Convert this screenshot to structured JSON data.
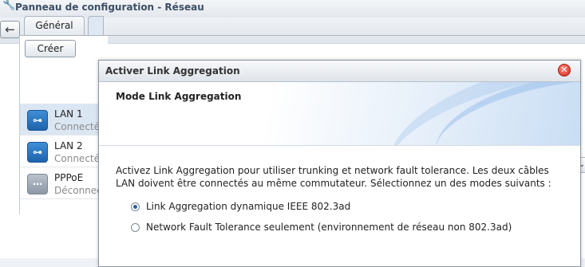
{
  "window": {
    "title": "Panneau de configuration - Réseau",
    "icon": "wrench-icon"
  },
  "toolbar": {
    "back_icon": "←",
    "forward_icon": "→",
    "home_icon": "⌂"
  },
  "tabs": {
    "general": "Général"
  },
  "list": {
    "create_label": "Créer",
    "items": [
      {
        "name": "LAN 1",
        "status": "Connecté",
        "icon": "network-link-icon"
      },
      {
        "name": "LAN 2",
        "status": "Connecté",
        "icon": "network-link-icon"
      },
      {
        "name": "PPPoE",
        "status": "Déconnecté",
        "icon": "pppoe-icon"
      }
    ]
  },
  "dialog": {
    "title": "Activer Link Aggregation",
    "close_glyph": "✕",
    "heading": "Mode Link Aggregation",
    "description": "Activez Link Aggregation pour utiliser trunking et network fault tolerance. Les deux câbles LAN doivent être connectés au même commutateur. Sélectionnez un des modes suivants :",
    "options": [
      {
        "label": "Link Aggregation dynamique IEEE 802.3ad",
        "checked": true
      },
      {
        "label": "Network Fault Tolerance seulement (environnement de réseau non 802.3ad)",
        "checked": false
      }
    ]
  },
  "colors": {
    "accent": "#1e63ad",
    "selection": "#dbe6f3",
    "close": "#d4281a"
  }
}
